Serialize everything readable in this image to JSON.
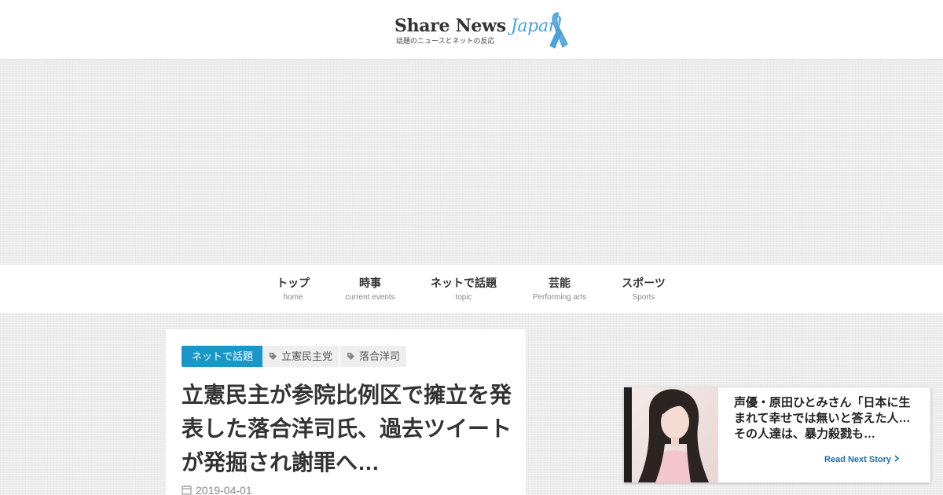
{
  "site": {
    "logo_word_a": "Share News",
    "logo_word_b": "Japan",
    "tagline": "話題のニュースとネットの反応",
    "brand_color": "#4aa3e0"
  },
  "nav": {
    "items": [
      {
        "label": "トップ",
        "sub": "home"
      },
      {
        "label": "時事",
        "sub": "current events"
      },
      {
        "label": "ネットで話題",
        "sub": "topic"
      },
      {
        "label": "芸能",
        "sub": "Performing arts"
      },
      {
        "label": "スポーツ",
        "sub": "Sports"
      }
    ]
  },
  "article": {
    "category": "ネットで話題",
    "category_color": "#1a97c9",
    "tags": [
      "立憲民主党",
      "落合洋司"
    ],
    "tag_icon": "tag-icon",
    "title": "立憲民主が参院比例区で擁立を発表した落合洋司氏、過去ツイートが発掘され謝罪へ…",
    "date": "2019-04-01",
    "date_icon": "calendar-icon"
  },
  "next_story": {
    "title": "声優・原田ひとみさん「日本に生まれて幸せでは無いと答えた人…その人達は、暴力殺戮も…",
    "link_label": "Read Next Story",
    "link_icon": "chevron-right-icon"
  }
}
